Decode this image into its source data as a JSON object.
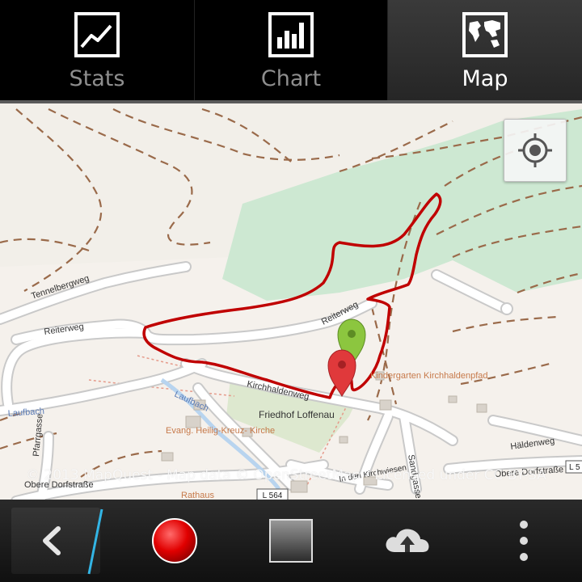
{
  "tabs": [
    {
      "label": "Stats",
      "icon": "line-chart-icon",
      "selected": false
    },
    {
      "label": "Chart",
      "icon": "bar-chart-icon",
      "selected": false
    },
    {
      "label": "Map",
      "icon": "world-map-icon",
      "selected": true
    }
  ],
  "map": {
    "attribution": "© 2013 MapQuest - Map data © OpenStreetMap - Licensed under CC BY-SA",
    "labels": {
      "tennelbergweg": "Tennelbergweg",
      "reiterweg_left": "Reiterweg",
      "reiterweg_right": "Reiterweg",
      "kirchhaldenweg": "Kirchhaldenweg",
      "laufbach_road": "Laufbach",
      "laufbach_stream": "Laufbach",
      "pfarrgasse": "Pfarrgasse",
      "kirche": "Evang. Heilig-Kreuz- Kirche",
      "friedhof": "Friedhof Loffenau",
      "kindergarten": "Kindergarten Kirchhaldenpfad",
      "sandgasse": "Sandgasse",
      "haldenweg": "Häldenweg",
      "obere_left": "Obere Dorfstraße",
      "obere_right": "Obere Dorfstraße",
      "l564": "L 564",
      "l5": "L 5",
      "rathaus": "Rathaus",
      "kirchwiesen": "In den Kirchwiesen"
    },
    "colors": {
      "track": "#c00000",
      "forest": "#cde8d2",
      "road": "#ffffff",
      "start_marker": "#8cc63f",
      "end_marker": "#e0393b"
    }
  },
  "toolbar": {
    "back": "chevron-left-icon",
    "record": "record-icon",
    "stop": "stop-icon",
    "upload": "cloud-upload-icon",
    "menu": "overflow-menu-icon"
  }
}
